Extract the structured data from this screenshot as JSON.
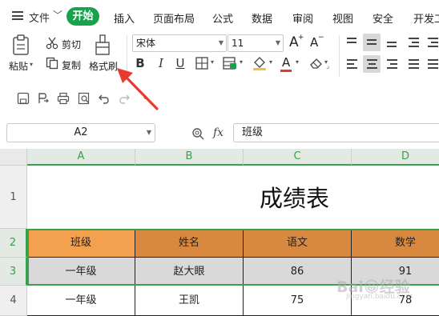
{
  "menu": {
    "file_label": "文件",
    "tabs": [
      "开始",
      "插入",
      "页面布局",
      "公式",
      "数据",
      "审阅",
      "视图",
      "安全",
      "开发工"
    ]
  },
  "ribbon": {
    "paste_label": "粘贴",
    "cut_label": "剪切",
    "copy_label": "复制",
    "format_painter_label": "格式刷",
    "font_name": "宋体",
    "font_size": "11",
    "grow_font": "A",
    "shrink_font": "A",
    "bold": "B",
    "italic": "I",
    "underline": "U"
  },
  "formula_bar": {
    "name_box": "A2",
    "fx_label": "fx",
    "formula_value": "班级"
  },
  "sheet": {
    "columns": [
      "A",
      "B",
      "C",
      "D"
    ],
    "row_numbers": [
      "1",
      "2",
      "3",
      "4"
    ],
    "title": "成绩表",
    "header": [
      "班级",
      "姓名",
      "语文",
      "数学"
    ],
    "rows": [
      [
        "一年级",
        "赵大眼",
        "86",
        "91"
      ],
      [
        "一年级",
        "王凯",
        "75",
        "78"
      ]
    ]
  },
  "watermark": {
    "text": "Bai😀经验",
    "sub": "jingyan.baidu.com"
  },
  "colors": {
    "accent_green": "#17a24b",
    "header_orange": "#d9893f",
    "header_orange_light": "#f3a04f",
    "row_grey": "#d9d9d9",
    "arrow_red": "#e83a2f"
  }
}
